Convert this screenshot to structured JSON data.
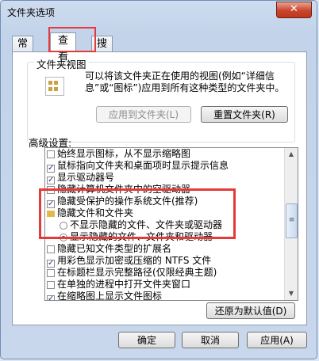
{
  "window": {
    "title": "文件夹选项",
    "close_glyph": "✕"
  },
  "tabs": [
    {
      "label": "常规"
    },
    {
      "label": "查看"
    },
    {
      "label": "搜索"
    }
  ],
  "folder_view": {
    "title": "文件夹视图",
    "description": "可以将该文件夹正在使用的视图(例如“详细信息”或“图标”)应用到所有这种类型的文件夹中。",
    "apply_button": "应用到文件夹(L)",
    "reset_button": "重置文件夹(R)"
  },
  "advanced": {
    "label": "高级设置:",
    "items": [
      {
        "type": "checkbox",
        "checked": false,
        "label": "始终显示图标，从不显示缩略图"
      },
      {
        "type": "checkbox",
        "checked": true,
        "label": "鼠标指向文件夹和桌面项时显示提示信息"
      },
      {
        "type": "checkbox",
        "checked": true,
        "label": "显示驱动器号"
      },
      {
        "type": "checkbox",
        "checked": false,
        "label": "隐藏计算机文件夹中的空驱动器"
      },
      {
        "type": "checkbox",
        "checked": true,
        "label": "隐藏受保护的操作系统文件(推荐)"
      },
      {
        "type": "folder",
        "label": "隐藏文件和文件夹"
      },
      {
        "type": "radio",
        "checked": false,
        "label": "不显示隐藏的文件、文件夹或驱动器"
      },
      {
        "type": "radio",
        "checked": true,
        "label": "显示隐藏的文件、文件夹和驱动器"
      },
      {
        "type": "checkbox",
        "checked": false,
        "label": "隐藏已知文件类型的扩展名"
      },
      {
        "type": "checkbox",
        "checked": true,
        "label": "用彩色显示加密或压缩的 NTFS 文件"
      },
      {
        "type": "checkbox",
        "checked": false,
        "label": "在标题栏显示完整路径(仅限经典主题)"
      },
      {
        "type": "checkbox",
        "checked": false,
        "label": "在单独的进程中打开文件夹窗口"
      },
      {
        "type": "checkbox",
        "checked": true,
        "label": "在缩略图上显示文件图标"
      }
    ],
    "restore_button": "还原为默认值(D)"
  },
  "footer": {
    "ok": "确定",
    "cancel": "取消",
    "apply": "应用(A)"
  },
  "colors": {
    "highlight": "#e43a3a",
    "accent": "#1f3e7d"
  }
}
